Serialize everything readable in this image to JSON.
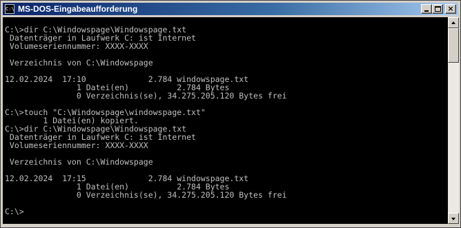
{
  "window": {
    "title": "MS-DOS-Eingabeaufforderung",
    "icon_label": "C:\\"
  },
  "console": {
    "lines": [
      "C:\\>dir C:\\Windowspage\\Windowspage.txt",
      " Datenträger in Laufwerk C: ist Internet",
      " Volumeseriennummer: XXXX-XXXX",
      "",
      " Verzeichnis von C:\\Windowspage",
      "",
      "12.02.2024  17:10             2.784 windowspage.txt",
      "               1 Datei(en)          2.784 Bytes",
      "               0 Verzeichnis(se), 34.275.205.120 Bytes frei",
      "",
      "C:\\>touch \"C:\\Windowspage\\windowspage.txt\"",
      "        1 Datei(en) kopiert.",
      "C:\\>dir C:\\Windowspage\\Windowspage.txt",
      " Datenträger in Laufwerk C: ist Internet",
      " Volumeseriennummer: XXXX-XXXX",
      "",
      " Verzeichnis von C:\\Windowspage",
      "",
      "12.02.2024  17:15             2.784 windowspage.txt",
      "               1 Datei(en)          2.784 Bytes",
      "               0 Verzeichnis(se), 34.275.205.120 Bytes frei",
      "",
      "C:\\>"
    ]
  },
  "colors": {
    "console_bg": "#000000",
    "console_fg": "#c0c0c0",
    "titlebar_start": "#0a246a",
    "titlebar_end": "#a6caf0"
  },
  "icons": {
    "app": "msdos-icon",
    "minimize": "minimize-icon",
    "maximize": "maximize-icon",
    "close": "close-icon"
  }
}
